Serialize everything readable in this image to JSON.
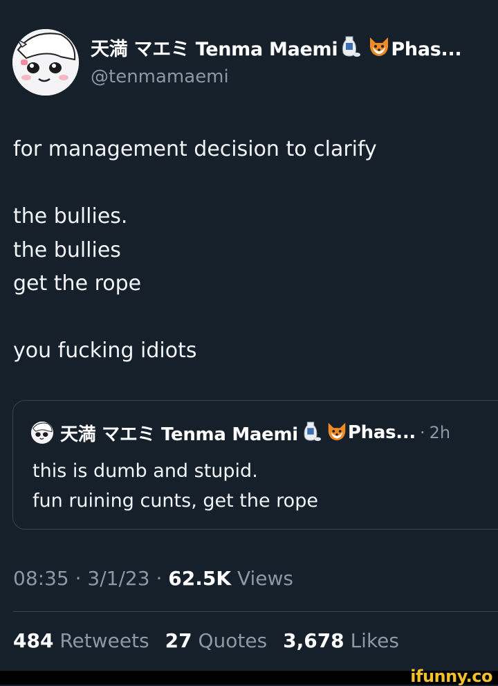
{
  "tweet": {
    "author": {
      "display_name": "天満 マエミ Tenma Maemi",
      "name_suffix": "Phas...",
      "handle": "@tenmamaemi",
      "emoji_icons": [
        "sake-icon",
        "fox-icon"
      ]
    },
    "text_lines": [
      "for management decision to clarify",
      "",
      "the bullies.",
      "the bullies",
      "get the rope",
      "",
      "you fucking idiots"
    ],
    "quoted": {
      "display_name": "天満 マエミ Tenma Maemi",
      "name_suffix": "Phas...",
      "separator": "·",
      "time": "2h",
      "text_lines": [
        "this is dumb and stupid.",
        "fun ruining cunts, get the rope"
      ]
    },
    "meta": {
      "time": "08:35",
      "sep1": "·",
      "date": "3/1/23",
      "sep2": "·",
      "views_count": "62.5K",
      "views_label": "Views"
    },
    "stats": {
      "retweets_count": "484",
      "retweets_label": "Retweets",
      "quotes_count": "27",
      "quotes_label": "Quotes",
      "likes_count": "3,678",
      "likes_label": "Likes"
    }
  },
  "watermark": "ifunny.co",
  "colors": {
    "background": "#15202b",
    "text_primary": "#ffffff",
    "text_secondary": "#8b98a5",
    "border": "#38444d",
    "watermark": "#f2c12e"
  }
}
